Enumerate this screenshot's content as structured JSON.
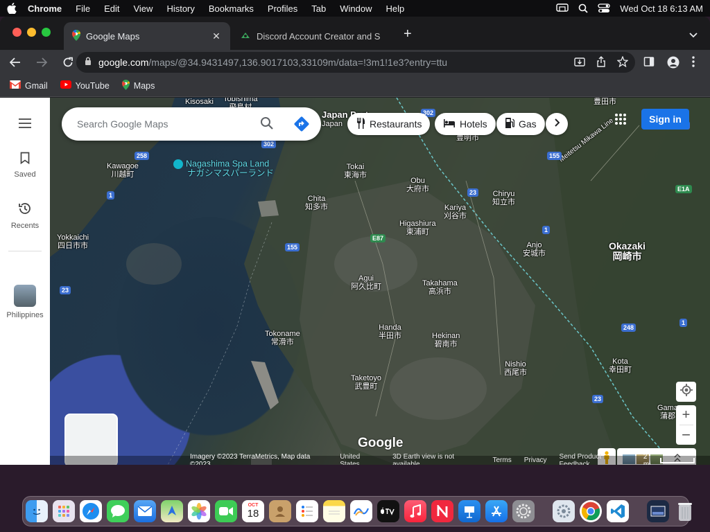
{
  "menubar": {
    "app_name": "Chrome",
    "items": [
      "File",
      "Edit",
      "View",
      "History",
      "Bookmarks",
      "Profiles",
      "Tab",
      "Window",
      "Help"
    ],
    "clock": "Wed Oct 18  6:13 AM"
  },
  "browser": {
    "tabs": [
      {
        "title": "Google Maps",
        "active": true,
        "icon": "google-maps-icon"
      },
      {
        "title": "Discord Account Creator and S",
        "active": false,
        "icon": "discord-icon"
      }
    ],
    "url_host": "google.com",
    "url_path": "/maps/@34.9431497,136.9017103,33109m/data=!3m1!1e3?entry=ttu",
    "bookmarks": [
      {
        "label": "Gmail",
        "icon": "gmail-icon"
      },
      {
        "label": "YouTube",
        "icon": "youtube-icon"
      },
      {
        "label": "Maps",
        "icon": "google-maps-icon"
      }
    ]
  },
  "maps": {
    "sidebar": {
      "saved": "Saved",
      "recents": "Recents",
      "recent_place": "Philippines"
    },
    "search": {
      "placeholder": "Search Google Maps"
    },
    "chips": [
      {
        "label": "Restaurants",
        "icon": "restaurant-icon"
      },
      {
        "label": "Hotels",
        "icon": "hotel-icon"
      },
      {
        "label": "Gas",
        "icon": "gas-icon"
      }
    ],
    "sign_in": "Sign in",
    "logo": "Google",
    "footer": {
      "imagery": "Imagery ©2023 TerraMetrics, Map data ©2023",
      "country": "United States",
      "earth_note": "3D Earth view is not available",
      "terms": "Terms",
      "privacy": "Privacy",
      "feedback": "Send Product Feedback",
      "scale": "2 mi"
    },
    "places": {
      "kisosaki": "Kisosaki",
      "tobishima": "Tobishima",
      "tobishima_jp": "飛島村",
      "japan_port": "Japan Port",
      "japan": "Japan",
      "kawagoe": "Kawagoe",
      "kawagoe_jp": "川越町",
      "nagashima": "Nagashima Spa Land",
      "nagashima_jp": "ナガシマスパーランド",
      "tokai": "Tokai",
      "tokai_jp": "東海市",
      "obu": "Obu",
      "obu_jp": "大府市",
      "chita": "Chita",
      "chita_jp": "知多市",
      "chiryu": "Chiryu",
      "chiryu_jp": "知立市",
      "kariya": "Kariya",
      "kariya_jp": "刈谷市",
      "higashiura": "Higashiura",
      "higashiura_jp": "東浦町",
      "yokkaichi": "Yokkaichi",
      "yokkaichi_jp": "四日市市",
      "anjo": "Anjo",
      "anjo_jp": "安城市",
      "okazaki": "Okazaki",
      "okazaki_jp": "岡崎市",
      "agui": "Agui",
      "agui_jp": "阿久比町",
      "takahama": "Takahama",
      "takahama_jp": "高浜市",
      "tokoname": "Tokoname",
      "tokoname_jp": "常滑市",
      "handa": "Handa",
      "handa_jp": "半田市",
      "hekinan": "Hekinan",
      "hekinan_jp": "碧南市",
      "nishio": "Nishio",
      "nishio_jp": "西尾市",
      "taketoyo": "Taketoyo",
      "taketoyo_jp": "武豊町",
      "kota": "Kota",
      "kota_jp": "幸田町",
      "gama": "Gama",
      "gama_jp": "蒲郡",
      "toyota_jp": "豊田市",
      "toyoake_jp": "豊明市",
      "meitetsu": "Meitetsu Mikawa Line"
    },
    "route_shields": [
      "302",
      "258",
      "1",
      "23",
      "155",
      "E87",
      "23",
      "1",
      "155",
      "302",
      "248",
      "1",
      "23",
      "E1A",
      "155"
    ]
  },
  "dock": {
    "calendar_month": "OCT",
    "calendar_day": "18",
    "apps": [
      "finder-icon",
      "launchpad-icon",
      "safari-icon",
      "messages-icon",
      "mail-icon",
      "maps-icon",
      "photos-icon",
      "facetime-icon",
      "calendar-icon",
      "contacts-icon",
      "reminders-icon",
      "notes-icon",
      "freeform-icon",
      "tv-icon",
      "music-icon",
      "news-icon",
      "keynote-icon",
      "app-store-icon",
      "system-settings-icon",
      "automator-icon",
      "chrome-icon",
      "vscode-icon",
      "preview-icon",
      "trash-icon"
    ]
  }
}
